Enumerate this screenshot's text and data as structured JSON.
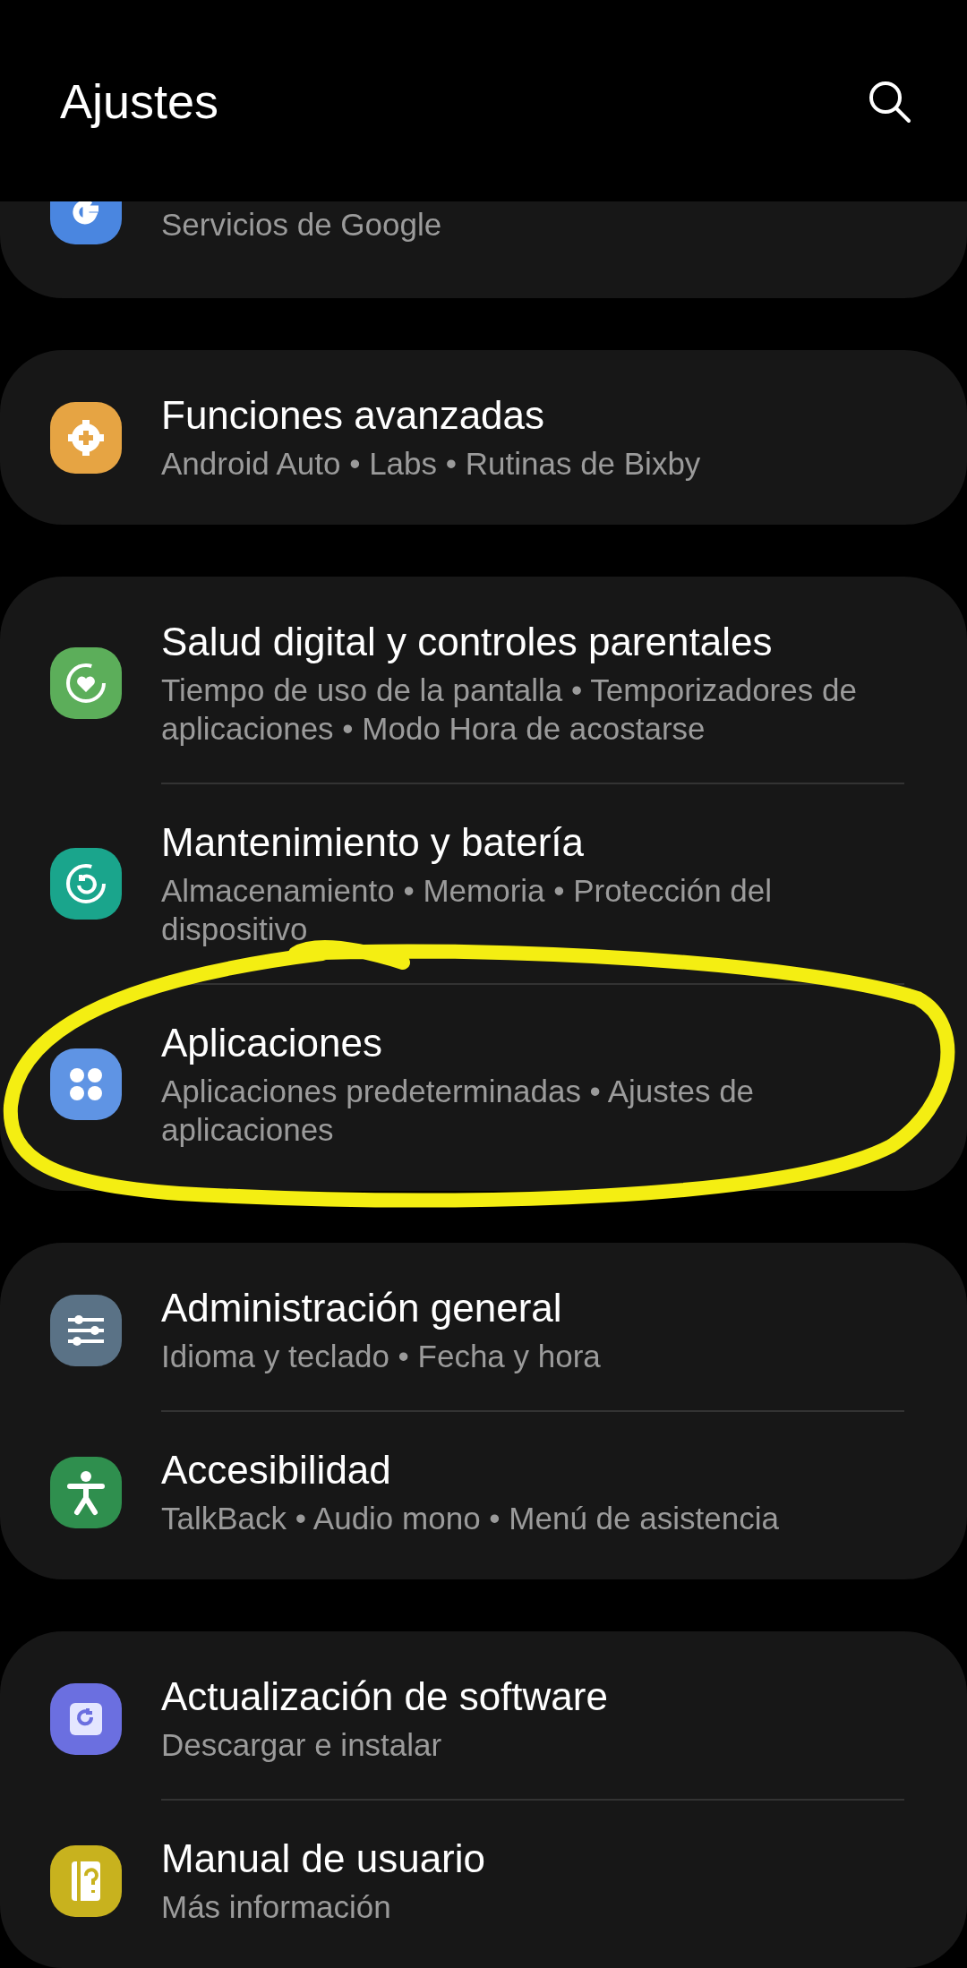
{
  "header": {
    "title": "Ajustes"
  },
  "groups": [
    {
      "items": [
        {
          "subtitle": "Servicios de Google"
        }
      ]
    },
    {
      "items": [
        {
          "title": "Funciones avanzadas",
          "subtitle": "Android Auto  •  Labs  •  Rutinas de Bixby"
        }
      ]
    },
    {
      "items": [
        {
          "title": "Salud digital y controles parentales",
          "subtitle": "Tiempo de uso de la pantalla  •  Temporizadores de aplicaciones  •  Modo Hora de acostarse"
        },
        {
          "title": "Mantenimiento y batería",
          "subtitle": "Almacenamiento  •  Memoria  •  Protección del dispositivo"
        },
        {
          "title": "Aplicaciones",
          "subtitle": "Aplicaciones predeterminadas  •  Ajustes de aplicaciones"
        }
      ]
    },
    {
      "items": [
        {
          "title": "Administración general",
          "subtitle": "Idioma y teclado  •  Fecha y hora"
        },
        {
          "title": "Accesibilidad",
          "subtitle": "TalkBack  •  Audio mono  •  Menú de asistencia"
        }
      ]
    },
    {
      "items": [
        {
          "title": "Actualización de software",
          "subtitle": "Descargar e instalar"
        },
        {
          "title": "Manual de usuario",
          "subtitle": "Más información"
        }
      ]
    }
  ]
}
